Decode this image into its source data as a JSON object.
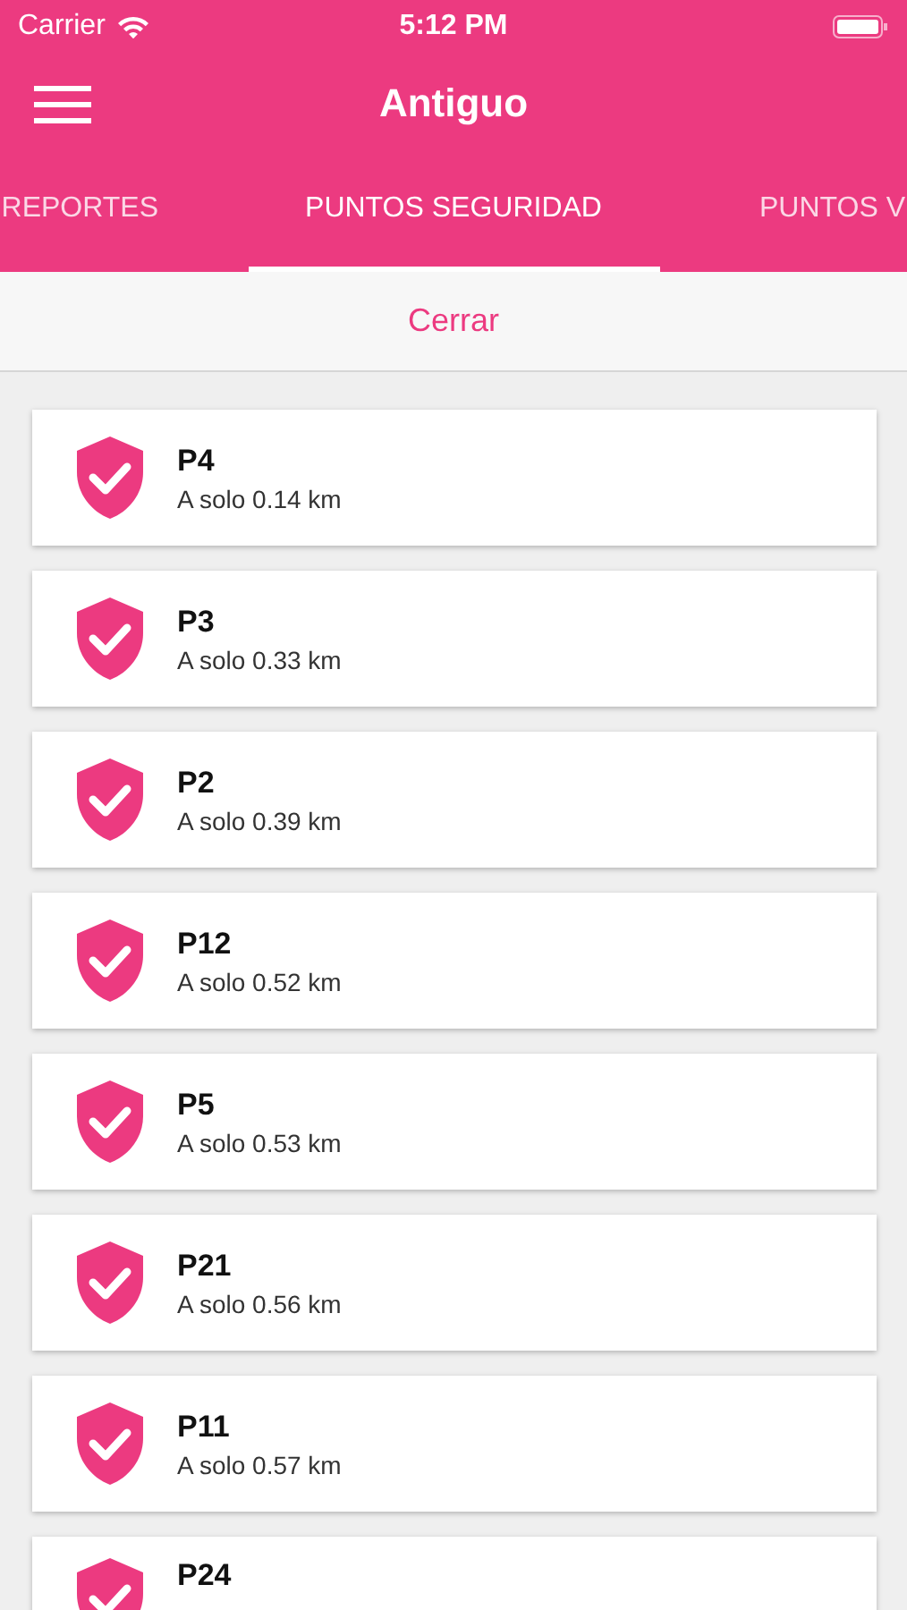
{
  "status_bar": {
    "carrier": "Carrier",
    "time": "5:12 PM"
  },
  "nav_bar": {
    "title": "Antiguo"
  },
  "tabs": [
    {
      "label": "REPORTES",
      "selected": false
    },
    {
      "label": "PUNTOS SEGURIDAD",
      "selected": true
    },
    {
      "label": "PUNTOS V",
      "selected": false
    }
  ],
  "close_button": "Cerrar",
  "points": [
    {
      "name": "P4",
      "distance": "A solo 0.14 km"
    },
    {
      "name": "P3",
      "distance": "A solo 0.33 km"
    },
    {
      "name": "P2",
      "distance": "A solo 0.39 km"
    },
    {
      "name": "P12",
      "distance": "A solo 0.52 km"
    },
    {
      "name": "P5",
      "distance": "A solo 0.53 km"
    },
    {
      "name": "P21",
      "distance": "A solo 0.56 km"
    },
    {
      "name": "P11",
      "distance": "A solo 0.57 km"
    },
    {
      "name": "P24"
    }
  ]
}
